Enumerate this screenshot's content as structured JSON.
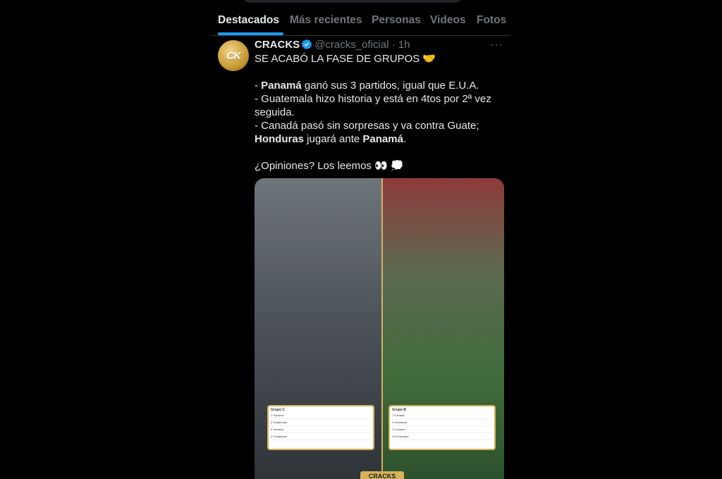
{
  "tabs": [
    {
      "label": "Destacados",
      "active": true
    },
    {
      "label": "Más recientes",
      "active": false
    },
    {
      "label": "Personas",
      "active": false
    },
    {
      "label": "Videos",
      "active": false
    },
    {
      "label": "Fotos",
      "active": false
    }
  ],
  "tweet": {
    "author": "CRACKS",
    "handle": "@cracks_oficial",
    "separator": " · ",
    "time": "1h",
    "avatar_text": "CK",
    "lines": {
      "l1": "SE ACABÓ LA FASE DE GRUPOS 🤝",
      "l2_bold": "Panamá",
      "l2_rest": " ganó sus 3 partidos, igual que E.U.A.",
      "l2_prefix": "- ",
      "l3": "- Guatemala hizo historia y está en 4tos por 2ª vez seguida.",
      "l4": "- Canadá pasó sin sorpresas y va contra Guate;",
      "l5_bold1": "Honduras",
      "l5_mid": " jugará ante ",
      "l5_bold2": "Panamá",
      "l5_end": ".",
      "l6": "¿Opiniones? Los leemos 👀 💭"
    },
    "media": {
      "brand": "CRACKS",
      "table_left": {
        "title": "Grupo C",
        "rows": [
          "1  Panamá",
          "2  Guatemala",
          "3  Jamaica",
          "4  Guadalupe"
        ]
      },
      "table_right": {
        "title": "Grupo B",
        "rows": [
          "1  Canadá",
          "2  Honduras",
          "3  Curazao",
          "4  El Salvador"
        ]
      }
    }
  },
  "colors": {
    "accent": "#1d9bf0",
    "muted": "#71767b",
    "text": "#e7e9ea",
    "gold": "#d6b25a"
  }
}
